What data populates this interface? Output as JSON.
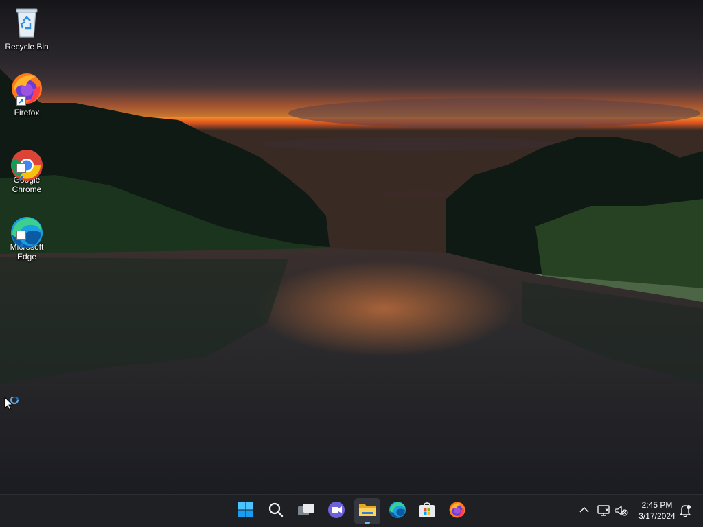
{
  "desktop": {
    "icons": [
      {
        "label": "Recycle Bin",
        "icon": "recycle-bin-icon"
      },
      {
        "label": "Firefox",
        "icon": "firefox-icon"
      },
      {
        "label": "Google\nChrome",
        "icon": "chrome-icon"
      },
      {
        "label": "Microsoft\nEdge",
        "icon": "edge-icon"
      }
    ]
  },
  "taskbar": {
    "apps": [
      {
        "name": "Start",
        "icon": "windows-start-icon"
      },
      {
        "name": "Search",
        "icon": "search-icon"
      },
      {
        "name": "Task View",
        "icon": "task-view-icon"
      },
      {
        "name": "Chat",
        "icon": "chat-icon"
      },
      {
        "name": "File Explorer",
        "icon": "folder-icon",
        "active": true
      },
      {
        "name": "Microsoft Edge",
        "icon": "edge-icon"
      },
      {
        "name": "Microsoft Store",
        "icon": "store-icon"
      },
      {
        "name": "Firefox",
        "icon": "firefox-icon"
      }
    ],
    "tray": {
      "icons": [
        "chevron-up-icon",
        "network-icon",
        "volume-muted-icon",
        "notification-icon"
      ],
      "time": "2:45 PM",
      "date": "3/17/2024"
    }
  },
  "colors": {
    "taskbar_bg": "#1f2024",
    "accent": "#76b9ed"
  }
}
